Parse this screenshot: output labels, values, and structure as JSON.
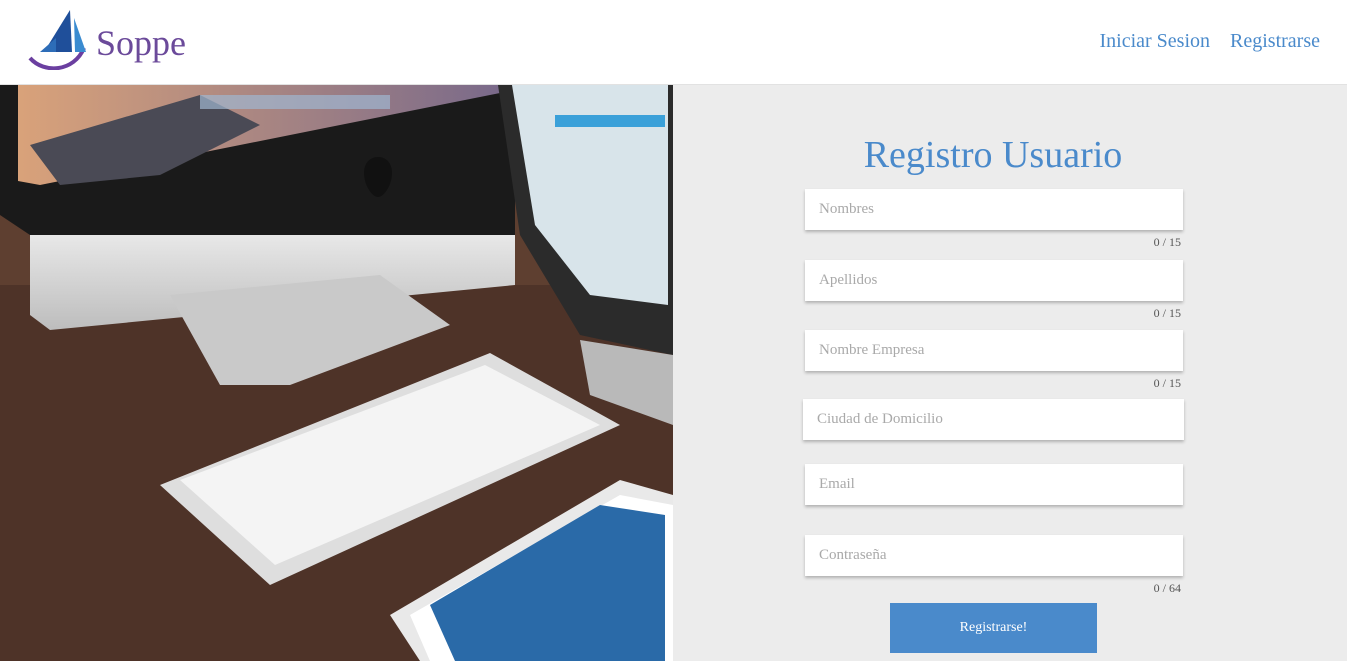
{
  "header": {
    "brand": "Soppe",
    "nav": [
      {
        "label": "Iniciar Sesion"
      },
      {
        "label": "Registrarse"
      }
    ]
  },
  "form": {
    "title": "Registro Usuario",
    "fields": [
      {
        "placeholder": "Nombres",
        "value": "",
        "counter": "0 / 15"
      },
      {
        "placeholder": "Apellidos",
        "value": "",
        "counter": "0 / 15"
      },
      {
        "placeholder": "Nombre Empresa",
        "value": "",
        "counter": "0 / 15"
      },
      {
        "placeholder": "Ciudad de Domicilio",
        "value": ""
      },
      {
        "placeholder": "Email",
        "value": ""
      },
      {
        "placeholder": "Contraseña",
        "value": "",
        "counter": "0 / 64"
      }
    ],
    "submit_label": "Registrarse!"
  },
  "colors": {
    "accent": "#4a8acb",
    "brand": "#6b4a9a",
    "background": "#ececec"
  },
  "icons": {
    "logo": "sailboat-logo"
  }
}
